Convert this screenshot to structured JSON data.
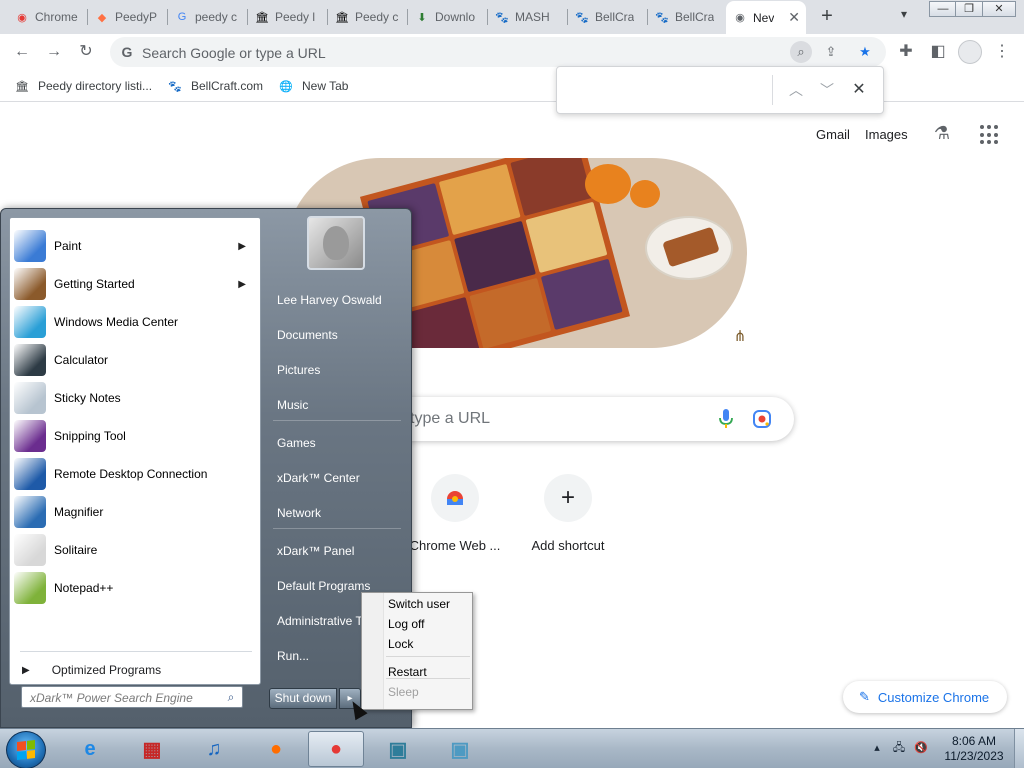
{
  "browser": {
    "tabs": [
      {
        "label": "Chrome",
        "icon": "chrome-icon",
        "color": "#e53935"
      },
      {
        "label": "PeedyP",
        "icon": "peedy-icon",
        "color": "#ff7043"
      },
      {
        "label": "peedy c",
        "icon": "google-icon",
        "color": "#4285f4"
      },
      {
        "label": "Peedy l",
        "icon": "building-icon",
        "color": "#000000"
      },
      {
        "label": "Peedy c",
        "icon": "building-icon",
        "color": "#000000"
      },
      {
        "label": "Downlo",
        "icon": "download-icon",
        "color": "#2e7d32"
      },
      {
        "label": "MASH",
        "icon": "paw-icon",
        "color": "#1a237e"
      },
      {
        "label": "BellCra",
        "icon": "paw-icon",
        "color": "#1a237e"
      },
      {
        "label": "BellCra",
        "icon": "paw-icon",
        "color": "#1a237e"
      },
      {
        "label": "Nev",
        "icon": "chrome-icon",
        "color": "#5f6368"
      }
    ],
    "new_tab_label": "+",
    "omnibox": {
      "placeholder": "Search Google or type a URL"
    },
    "bookmarks": [
      {
        "label": "Peedy directory listi...",
        "icon": "building-icon"
      },
      {
        "label": "BellCraft.com",
        "icon": "paw-icon"
      },
      {
        "label": "New Tab",
        "icon": "globe-icon"
      }
    ],
    "findbar": {
      "value": ""
    }
  },
  "ntp": {
    "gmail": "Gmail",
    "images": "Images",
    "search_placeholder": "type a URL",
    "shortcuts": [
      {
        "label": "Chrome Web ...",
        "icon": "chrome-web-store-icon"
      },
      {
        "label": "Add shortcut",
        "icon": "plus-icon"
      }
    ],
    "customize": "Customize Chrome"
  },
  "start_menu": {
    "programs": [
      {
        "label": "Paint",
        "has_submenu": true,
        "color": "#3a7bd5"
      },
      {
        "label": "Getting Started",
        "has_submenu": true,
        "color": "#8b5a2b"
      },
      {
        "label": "Windows Media Center",
        "has_submenu": false,
        "color": "#2a9fd6"
      },
      {
        "label": "Calculator",
        "has_submenu": false,
        "color": "#2d3b45"
      },
      {
        "label": "Sticky Notes",
        "has_submenu": false,
        "color": "#b7c4d0"
      },
      {
        "label": "Snipping Tool",
        "has_submenu": false,
        "color": "#6b2d8f"
      },
      {
        "label": "Remote Desktop Connection",
        "has_submenu": false,
        "color": "#1e5aa8"
      },
      {
        "label": "Magnifier",
        "has_submenu": false,
        "color": "#2b6cb3"
      },
      {
        "label": "Solitaire",
        "has_submenu": false,
        "color": "#d8d8d8"
      },
      {
        "label": "Notepad++",
        "has_submenu": false,
        "color": "#7fb23a"
      }
    ],
    "optimized_programs": "Optimized Programs",
    "search_placeholder": "xDark™ Power Search Engine",
    "right_items": [
      "Lee Harvey Oswald",
      "Documents",
      "Pictures",
      "Music",
      "Games",
      "xDark™ Center",
      "Network",
      "xDark™ Panel",
      "Default Programs",
      "Administrative Tools",
      "Run..."
    ],
    "shutdown_label": "Shut down",
    "shutdown_options": [
      {
        "label": "Switch user",
        "enabled": true
      },
      {
        "label": "Log off",
        "enabled": true
      },
      {
        "label": "Lock",
        "enabled": true
      },
      {
        "label": "Restart",
        "enabled": true
      },
      {
        "label": "Sleep",
        "enabled": false
      }
    ]
  },
  "taskbar": {
    "apps": [
      {
        "name": "internet-explorer",
        "icon": "e",
        "color": "#1e88e5"
      },
      {
        "name": "store",
        "icon": "▦",
        "color": "#c62828"
      },
      {
        "name": "music",
        "icon": "♫",
        "color": "#1565c0"
      },
      {
        "name": "firefox",
        "icon": "●",
        "color": "#ff6d00"
      },
      {
        "name": "chrome",
        "icon": "●",
        "color": "#e53935",
        "active": true
      },
      {
        "name": "photos",
        "icon": "▣",
        "color": "#2e7d9a"
      },
      {
        "name": "photos-2",
        "icon": "▣",
        "color": "#4e9ac2"
      }
    ],
    "clock_time": "8:06 AM",
    "clock_date": "11/23/2023"
  }
}
